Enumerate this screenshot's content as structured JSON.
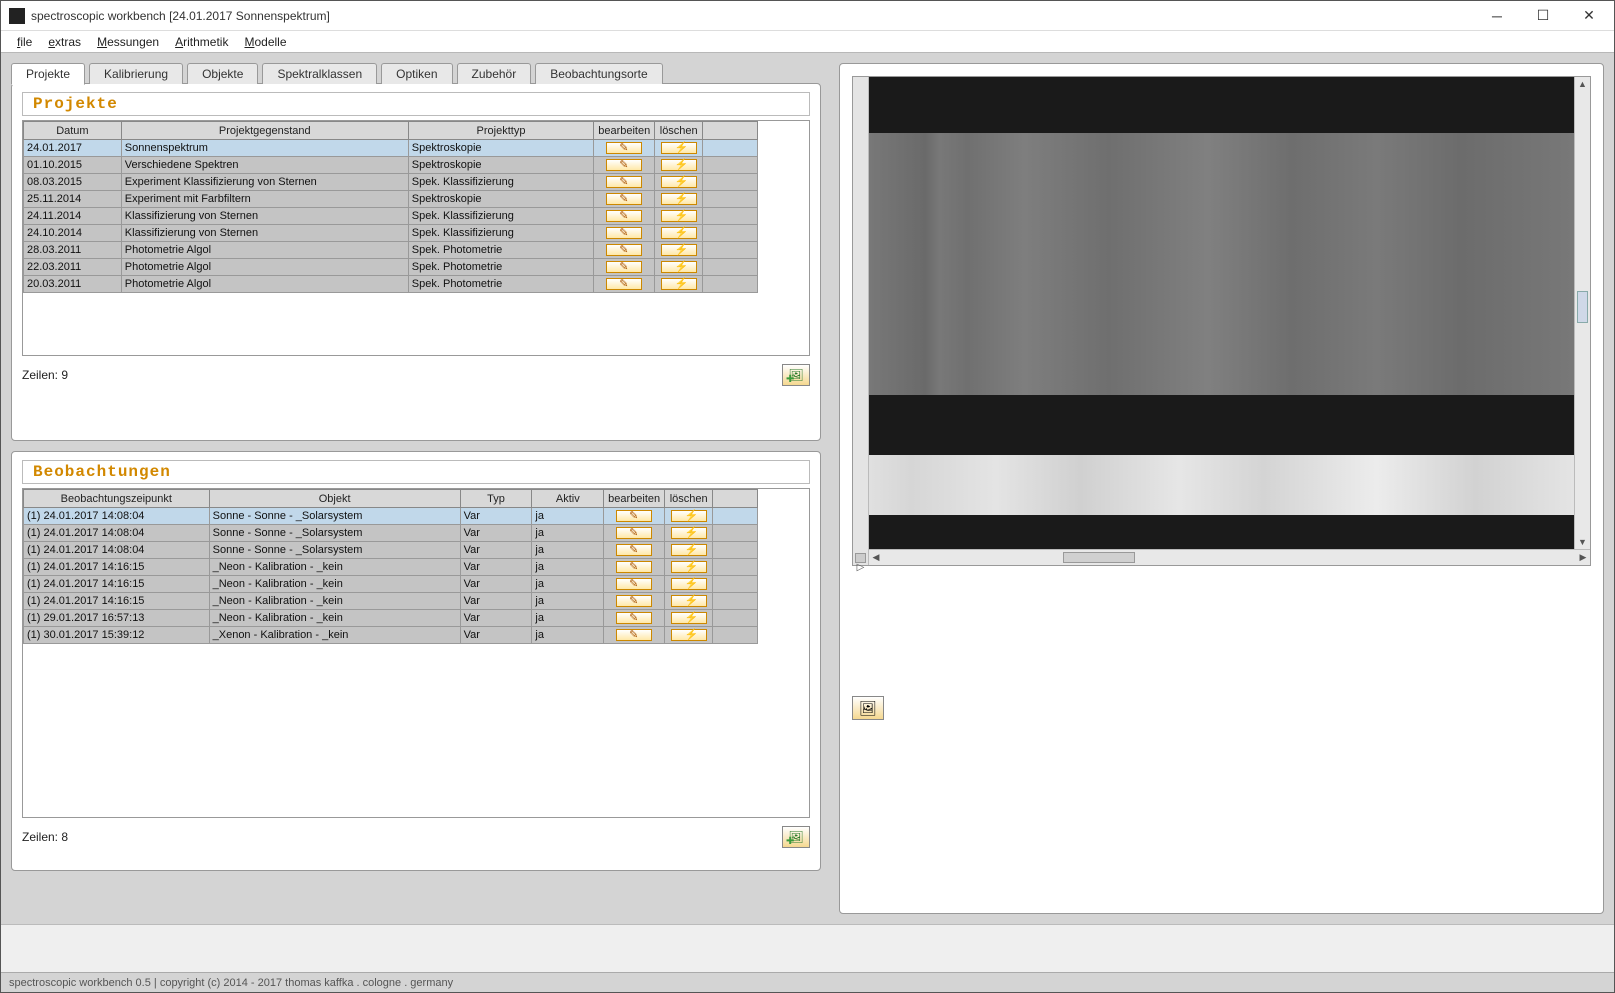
{
  "window": {
    "title": "spectroscopic workbench [24.01.2017 Sonnenspektrum]"
  },
  "menu": {
    "items": [
      "file",
      "extras",
      "Messungen",
      "Arithmetik",
      "Modelle"
    ]
  },
  "tabs": {
    "items": [
      "Projekte",
      "Kalibrierung",
      "Objekte",
      "Spektralklassen",
      "Optiken",
      "Zubehör",
      "Beobachtungsorte"
    ],
    "active_index": 0
  },
  "projects": {
    "title": "Projekte",
    "headers": [
      "Datum",
      "Projektgegenstand",
      "Projekttyp",
      "bearbeiten",
      "löschen"
    ],
    "rows": [
      {
        "date": "24.01.2017",
        "subject": "Sonnenspektrum",
        "type": "Spektroskopie",
        "selected": true
      },
      {
        "date": "01.10.2015",
        "subject": "Verschiedene Spektren",
        "type": "Spektroskopie"
      },
      {
        "date": "08.03.2015",
        "subject": "Experiment Klassifizierung von Sternen",
        "type": "Spek. Klassifizierung"
      },
      {
        "date": "25.11.2014",
        "subject": "Experiment mit Farbfiltern",
        "type": "Spektroskopie"
      },
      {
        "date": "24.11.2014",
        "subject": "Klassifizierung von Sternen",
        "type": "Spek. Klassifizierung"
      },
      {
        "date": "24.10.2014",
        "subject": "Klassifizierung von Sternen",
        "type": "Spek. Klassifizierung"
      },
      {
        "date": "28.03.2011",
        "subject": "Photometrie Algol",
        "type": "Spek. Photometrie"
      },
      {
        "date": "22.03.2011",
        "subject": "Photometrie Algol",
        "type": "Spek. Photometrie"
      },
      {
        "date": "20.03.2011",
        "subject": "Photometrie Algol",
        "type": "Spek. Photometrie"
      }
    ],
    "row_count_label": "Zeilen: 9"
  },
  "observations": {
    "title": "Beobachtungen",
    "headers": [
      "Beobachtungszeipunkt",
      "Objekt",
      "Typ",
      "Aktiv",
      "bearbeiten",
      "löschen"
    ],
    "rows": [
      {
        "time": "(1) 24.01.2017 14:08:04",
        "object": "Sonne - Sonne - _Solarsystem",
        "type": "Var",
        "active": "ja",
        "selected": true
      },
      {
        "time": "(1) 24.01.2017 14:08:04",
        "object": "Sonne - Sonne - _Solarsystem",
        "type": "Var",
        "active": "ja"
      },
      {
        "time": "(1) 24.01.2017 14:08:04",
        "object": "Sonne - Sonne - _Solarsystem",
        "type": "Var",
        "active": "ja"
      },
      {
        "time": "(1) 24.01.2017 14:16:15",
        "object": "_Neon - Kalibration - _kein",
        "type": "Var",
        "active": "ja"
      },
      {
        "time": "(1) 24.01.2017 14:16:15",
        "object": "_Neon - Kalibration - _kein",
        "type": "Var",
        "active": "ja"
      },
      {
        "time": "(1) 24.01.2017 14:16:15",
        "object": "_Neon - Kalibration - _kein",
        "type": "Var",
        "active": "ja"
      },
      {
        "time": "(1) 29.01.2017 16:57:13",
        "object": "_Neon - Kalibration - _kein",
        "type": "Var",
        "active": "ja"
      },
      {
        "time": "(1) 30.01.2017 15:39:12",
        "object": "_Xenon - Kalibration - _kein",
        "type": "Var",
        "active": "ja"
      }
    ],
    "row_count_label": "Zeilen: 8"
  },
  "statusbar": {
    "text": "spectroscopic workbench 0.5 | copyright (c) 2014 - 2017 thomas kaffka . cologne . germany"
  }
}
